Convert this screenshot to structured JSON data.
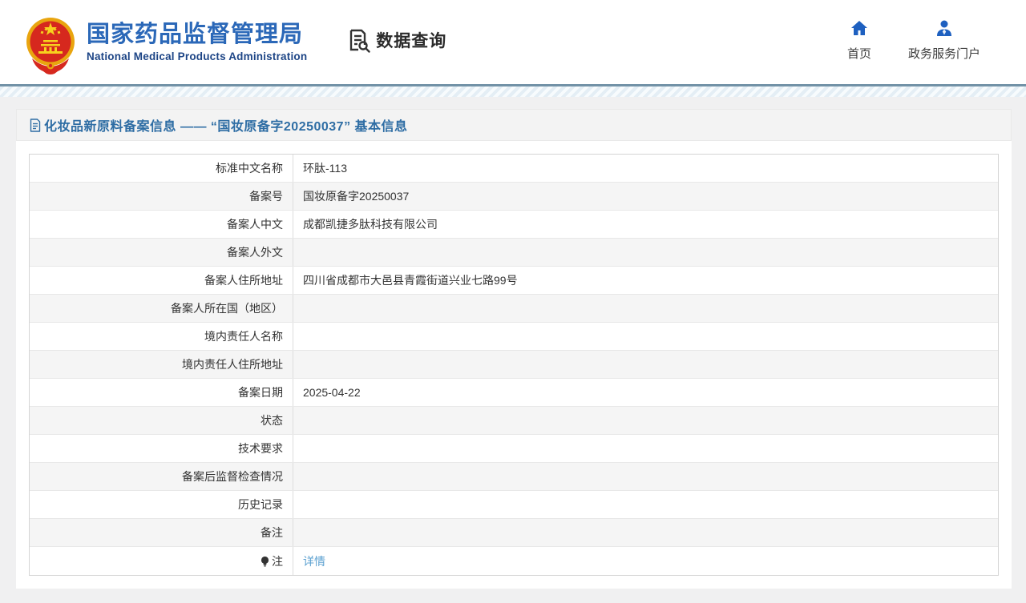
{
  "header": {
    "brand": {
      "title_cn": "国家药品监督管理局",
      "title_en": "National Medical Products Administration",
      "emblem_icon": "china-national-emblem",
      "brand_color": "#2b68b8"
    },
    "section": {
      "label": "数据查询",
      "icon": "document-search-icon"
    },
    "nav": [
      {
        "label": "首页",
        "icon": "home-icon"
      },
      {
        "label": "政务服务门户",
        "icon": "person-icon"
      }
    ],
    "accent_blue": "#1e60c0"
  },
  "page": {
    "title": "化妆品新原料备案信息 —— “国妆原备字20250037” 基本信息",
    "title_color": "#2e6da4"
  },
  "table": {
    "rows": [
      {
        "label": "标准中文名称",
        "value": "环肽-113"
      },
      {
        "label": "备案号",
        "value": "国妆原备字20250037"
      },
      {
        "label": "备案人中文",
        "value": "成都凯捷多肽科技有限公司"
      },
      {
        "label": "备案人外文",
        "value": ""
      },
      {
        "label": "备案人住所地址",
        "value": "四川省成都市大邑县青霞街道兴业七路99号"
      },
      {
        "label": "备案人所在国（地区）",
        "value": ""
      },
      {
        "label": "境内责任人名称",
        "value": ""
      },
      {
        "label": "境内责任人住所地址",
        "value": ""
      },
      {
        "label": "备案日期",
        "value": "2025-04-22"
      },
      {
        "label": "状态",
        "value": ""
      },
      {
        "label": "技术要求",
        "value": ""
      },
      {
        "label": "备案后监督检查情况",
        "value": ""
      },
      {
        "label": "历史记录",
        "value": ""
      },
      {
        "label": "备注",
        "value": ""
      },
      {
        "label": "注",
        "value": "详情",
        "label_icon": "bulb-icon",
        "value_is_link": true
      }
    ],
    "link_color": "#5ba0d0",
    "alt_row_color": "#f5f5f5"
  }
}
